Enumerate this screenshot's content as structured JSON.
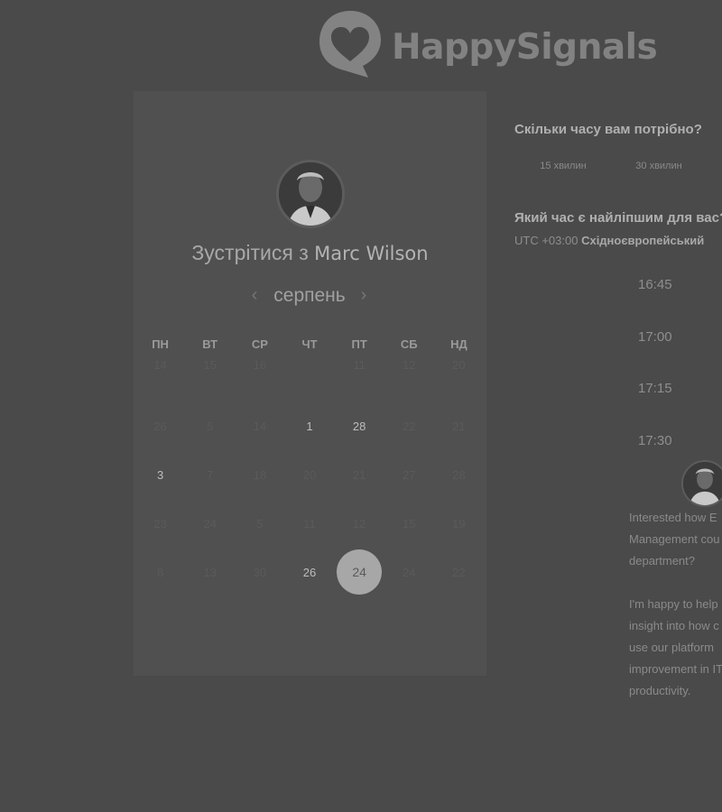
{
  "brand": {
    "name": "HappySignals",
    "logo_icon": "heart-speech-bubble-logo"
  },
  "card": {
    "title_prefix": "Зустрітися з",
    "host_name": "Marc Wilson",
    "month": "серпень",
    "weekdays": [
      "ПН",
      "ВТ",
      "СР",
      "ЧТ",
      "ПТ",
      "СБ",
      "НД"
    ],
    "days": [
      {
        "d": "14",
        "avail": false
      },
      {
        "d": "15",
        "avail": false
      },
      {
        "d": "16",
        "avail": false
      },
      {
        "d": "",
        "avail": false
      },
      {
        "d": "11",
        "avail": false
      },
      {
        "d": "12",
        "avail": false
      },
      {
        "d": "20",
        "avail": false
      },
      {
        "d": "26",
        "avail": false
      },
      {
        "d": "5",
        "avail": false
      },
      {
        "d": "14",
        "avail": false
      },
      {
        "d": "1",
        "avail": true
      },
      {
        "d": "28",
        "avail": true
      },
      {
        "d": "22",
        "avail": false
      },
      {
        "d": "21",
        "avail": false
      },
      {
        "d": "3",
        "avail": true
      },
      {
        "d": "7",
        "avail": false
      },
      {
        "d": "18",
        "avail": false
      },
      {
        "d": "20",
        "avail": false
      },
      {
        "d": "21",
        "avail": false
      },
      {
        "d": "27",
        "avail": false
      },
      {
        "d": "28",
        "avail": false
      },
      {
        "d": "23",
        "avail": false
      },
      {
        "d": "24",
        "avail": false
      },
      {
        "d": "5",
        "avail": false
      },
      {
        "d": "11",
        "avail": false
      },
      {
        "d": "12",
        "avail": false
      },
      {
        "d": "15",
        "avail": false
      },
      {
        "d": "19",
        "avail": false
      },
      {
        "d": "8",
        "avail": false
      },
      {
        "d": "13",
        "avail": false
      },
      {
        "d": "30",
        "avail": false
      },
      {
        "d": "26",
        "avail": true
      },
      {
        "d": "24",
        "avail": true,
        "selected": true
      },
      {
        "d": "24",
        "avail": false
      },
      {
        "d": "22",
        "avail": false
      }
    ]
  },
  "duration": {
    "question": "Скільки часу вам потрібно?",
    "options": [
      "15 хвилин",
      "30 хвилин"
    ]
  },
  "timeslot": {
    "question": "Який час є найліпшим для вас?",
    "tz_offset": "UTC +03:00",
    "tz_name": "Східноєвропейський",
    "times": [
      "16:45",
      "17:00",
      "17:15",
      "17:30"
    ]
  },
  "description": {
    "lines_p1": [
      "Interested how E",
      "Management cou",
      "department?"
    ],
    "lines_p2": [
      "I'm happy to help",
      "insight into how c",
      "use our platform",
      "improvement in IT",
      "productivity."
    ]
  }
}
